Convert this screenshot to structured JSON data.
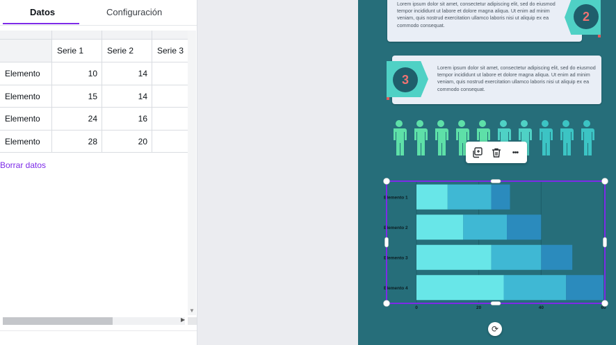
{
  "tabs": {
    "data_label": "Datos",
    "config_label": "Configuración"
  },
  "table": {
    "headers": [
      "",
      "Serie 1",
      "Serie 2",
      "Serie 3"
    ],
    "rows": [
      {
        "label": "Elemento",
        "s1": "10",
        "s2": "14",
        "s3": ""
      },
      {
        "label": "Elemento",
        "s1": "15",
        "s2": "14",
        "s3": ""
      },
      {
        "label": "Elemento",
        "s1": "24",
        "s2": "16",
        "s3": ""
      },
      {
        "label": "Elemento",
        "s1": "28",
        "s2": "20",
        "s3": ""
      }
    ]
  },
  "clear_data_label": "Borrar datos",
  "cards": [
    {
      "number": "2",
      "text": "Lorem ipsum dolor sit amet, consectetur adipiscing elit, sed do eiusmod tempor incididunt ut labore et dolore magna aliqua. Ut enim ad minim veniam, quis nostrud exercitation ullamco laboris nisi ut aliquip ex ea commodo consequat."
    },
    {
      "number": "3",
      "text": "Lorem ipsum dolor sit amet, consectetur adipiscing elit, sed do eiusmod tempor incididunt ut labore et dolore magna aliqua. Ut enim ad minim veniam, quis nostrud exercitation ullamco laboris nisi ut aliquip ex ea commodo consequat."
    }
  ],
  "people": {
    "count": 10,
    "colors": [
      "#5ee0a8",
      "#5ee0a8",
      "#5ee0a8",
      "#5ee0a8",
      "#5ee0a8",
      "#4fd1c5",
      "#4fd1c5",
      "#3cc4c4",
      "#3cc4c4",
      "#3cc4c4"
    ]
  },
  "toolbar": {
    "duplicate_icon": "duplicate-icon",
    "delete_icon": "trash-icon",
    "more_icon": "more-icon",
    "more_glyph": "•••"
  },
  "colors": {
    "accent": "#7d2ae8",
    "page_bg": "#266e7a",
    "series": [
      "#68e6e8",
      "#3fb8d4",
      "#2b8bbd"
    ]
  },
  "chart_data": {
    "type": "bar",
    "orientation": "horizontal",
    "stacked": true,
    "categories": [
      "Elemento 1",
      "Elemento 2",
      "Elemento 3",
      "Elemento 4"
    ],
    "series": [
      {
        "values": [
          10,
          15,
          24,
          28
        ]
      },
      {
        "values": [
          14,
          14,
          16,
          20
        ]
      },
      {
        "values": [
          6,
          11,
          10,
          12
        ]
      }
    ],
    "x_ticks": [
      "0",
      "20",
      "40",
      "60"
    ],
    "xlim": [
      0,
      60
    ],
    "grid": true
  }
}
